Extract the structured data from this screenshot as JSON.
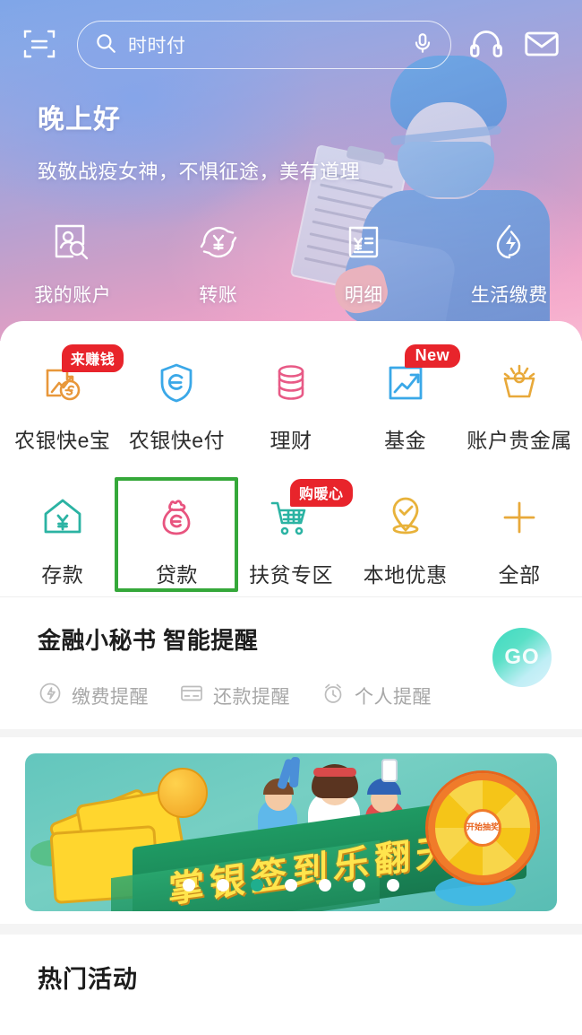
{
  "topbar": {
    "scan_icon": "scan-icon",
    "search_text": "时时付",
    "search_icon": "search-icon",
    "mic_icon": "microphone-icon",
    "headset_icon": "headset-icon",
    "mail_icon": "envelope-icon"
  },
  "hero": {
    "greeting": "晚上好",
    "subtitle": "致敬战疫女神，不惧征途，美有道理",
    "quick_actions": [
      {
        "label": "我的账户",
        "icon": "account-search-icon"
      },
      {
        "label": "转账",
        "icon": "transfer-yuan-icon"
      },
      {
        "label": "明细",
        "icon": "statement-icon"
      },
      {
        "label": "生活缴费",
        "icon": "utility-payment-icon"
      }
    ]
  },
  "grid": {
    "rows": [
      [
        {
          "label": "农银快e宝",
          "icon": "kuai-e-bao-icon",
          "badge": "来赚钱",
          "badge_type": "cn",
          "selected": false
        },
        {
          "label": "农银快e付",
          "icon": "kuai-e-fu-shield-icon",
          "badge": "",
          "selected": false
        },
        {
          "label": "理财",
          "icon": "wealth-coins-icon",
          "badge": "",
          "selected": false
        },
        {
          "label": "基金",
          "icon": "fund-chart-icon",
          "badge": "New",
          "badge_type": "en",
          "selected": false
        },
        {
          "label": "账户贵金属",
          "icon": "precious-metal-icon",
          "badge": "",
          "selected": false
        }
      ],
      [
        {
          "label": "存款",
          "icon": "deposit-house-icon",
          "badge": "",
          "selected": false
        },
        {
          "label": "贷款",
          "icon": "loan-money-bag-icon",
          "badge": "",
          "selected": true
        },
        {
          "label": "扶贫专区",
          "icon": "poverty-relief-cart-icon",
          "badge": "购暖心",
          "badge_type": "cn",
          "selected": false
        },
        {
          "label": "本地优惠",
          "icon": "local-offer-pin-icon",
          "badge": "",
          "selected": false
        },
        {
          "label": "全部",
          "icon": "plus-all-icon",
          "badge": "",
          "selected": false
        }
      ]
    ]
  },
  "assistant": {
    "title": "金融小秘书 智能提醒",
    "go_label": "GO",
    "chips": [
      {
        "label": "缴费提醒",
        "icon": "payment-reminder-icon"
      },
      {
        "label": "还款提醒",
        "icon": "repayment-card-icon"
      },
      {
        "label": "个人提醒",
        "icon": "alarm-clock-icon"
      }
    ]
  },
  "banner": {
    "title": "掌银签到乐翻天",
    "wheel_center": "开始抽奖",
    "dots_total": 7,
    "dots_active_index": 2
  },
  "hot": {
    "title": "热门活动"
  },
  "colors": {
    "badge_red": "#e8242b",
    "selection_green": "#35a83a",
    "active_dot_teal": "#1fae8e",
    "banner_green": "#1f9a63",
    "banner_title_yellow": "#ffe54d"
  }
}
